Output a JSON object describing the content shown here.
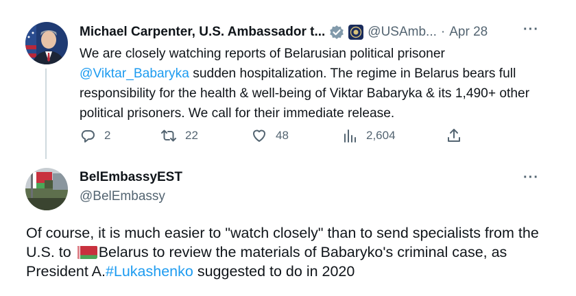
{
  "tweet1": {
    "author_name": "Michael Carpenter, U.S. Ambassador t...",
    "handle": "@USAmb...",
    "separator": "·",
    "date": "Apr 28",
    "more": "···",
    "text_before": "We are closely watching reports of Belarusian political prisoner ",
    "mention": "@Viktar_Babaryka",
    "text_after": " sudden hospitalization. The regime in Belarus bears full responsibility for the health & well-being of Viktar Babaryka & its 1,490+ other political prisoners. We call for their immediate release.",
    "actions": {
      "replies": "2",
      "retweets": "22",
      "likes": "48",
      "views": "2,604"
    },
    "icons": [
      "verified-badge-icon",
      "org-seal-icon",
      "reply-icon",
      "retweet-icon",
      "like-icon",
      "views-icon",
      "share-icon",
      "more-icon"
    ]
  },
  "tweet2": {
    "author_name": "BelEmbassyEST",
    "handle": "@BelEmbassy",
    "more": "···",
    "text_1": "Of course, it is much easier to \"watch closely\" than to send specialists from the U.S. to ",
    "text_2": "Belarus to review the materials of Babaryko's criminal case, as President A.",
    "hashtag": "#Lukashenko",
    "text_3": " suggested to do in 2020",
    "icons": [
      "belarus-flag-icon",
      "more-icon"
    ]
  },
  "colors": {
    "link": "#1d9bf0",
    "secondary_text": "#536471",
    "primary_text": "#0f1419",
    "verified_badge": "#829aab",
    "thread_line": "#cfd9de"
  }
}
